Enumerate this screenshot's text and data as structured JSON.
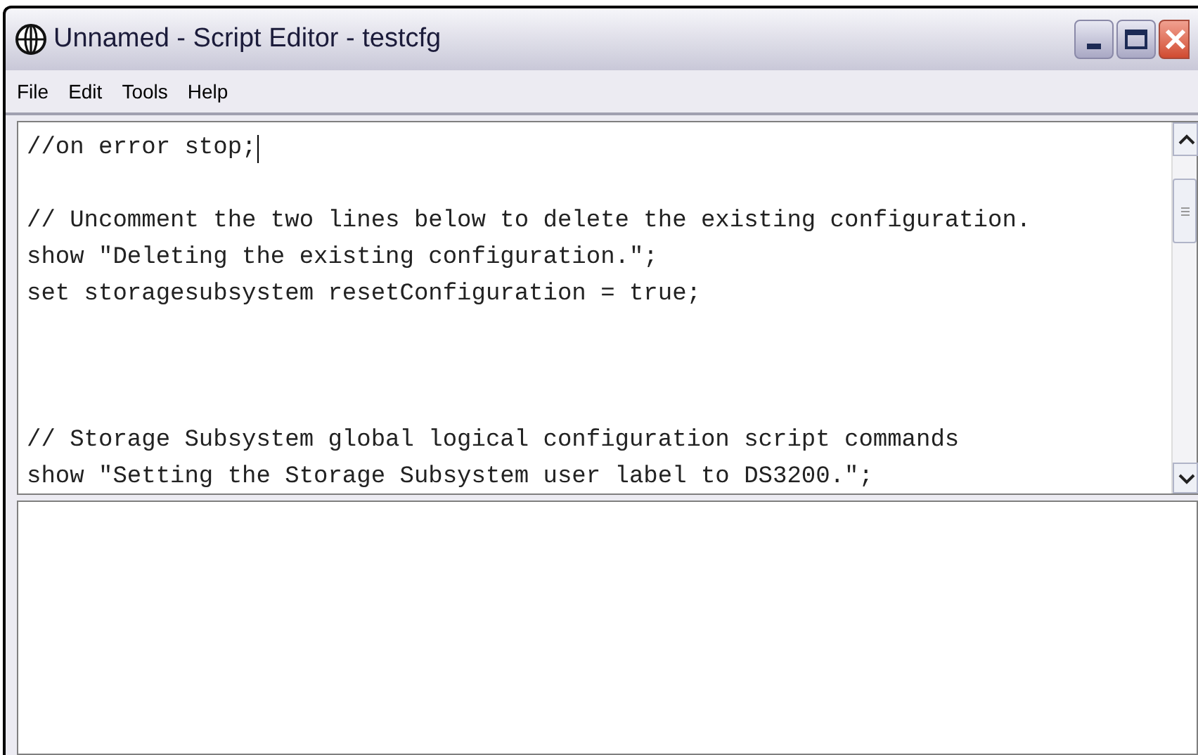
{
  "window": {
    "title": "Unnamed - Script Editor - testcfg"
  },
  "menu": [
    {
      "label": "File"
    },
    {
      "label": "Edit"
    },
    {
      "label": "Tools"
    },
    {
      "label": "Help"
    }
  ],
  "editor": {
    "lines": [
      {
        "kind": "code",
        "text": "//on error stop;",
        "cursor": true
      },
      {
        "kind": "blank"
      },
      {
        "kind": "code",
        "text": "// Uncomment the two lines below to delete the existing configuration.",
        "cursor": false
      },
      {
        "kind": "code",
        "text": "show \"Deleting the existing configuration.\";",
        "cursor": false
      },
      {
        "kind": "code",
        "text": "set storagesubsystem resetConfiguration = true;",
        "cursor": false
      },
      {
        "kind": "blank"
      },
      {
        "kind": "blank"
      },
      {
        "kind": "blank"
      },
      {
        "kind": "code",
        "text": "// Storage Subsystem global logical configuration script commands",
        "cursor": false
      },
      {
        "kind": "code",
        "text": "show \"Setting the Storage Subsystem user label to DS3200.\";",
        "cursor": false
      }
    ]
  }
}
